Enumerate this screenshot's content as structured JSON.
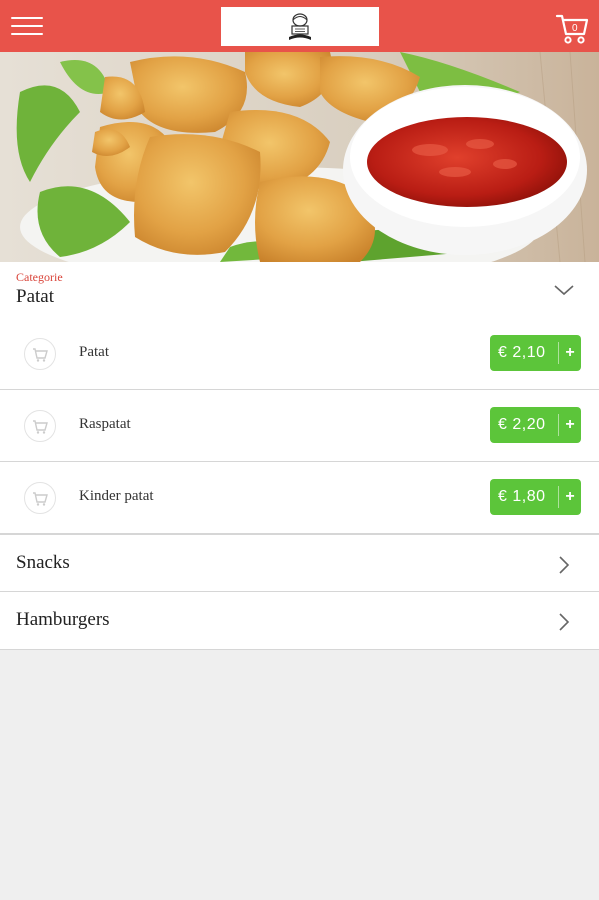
{
  "header": {
    "menu_icon": "hamburger-menu-icon",
    "logo_alt": "restaurant-logo",
    "cart_icon": "shopping-cart-icon",
    "cart_count": "0",
    "bar_color": "#e8534a"
  },
  "hero": {
    "description": "hero-image-chicken-nuggets-ketchup"
  },
  "category": {
    "label": "Categorie",
    "title": "Patat",
    "chevron_icon": "chevron-down-icon"
  },
  "items": [
    {
      "name": "Patat",
      "price": "€ 2,10",
      "add": "+"
    },
    {
      "name": "Raspatat",
      "price": "€ 2,20",
      "add": "+"
    },
    {
      "name": "Kinder patat",
      "price": "€ 1,80",
      "add": "+"
    }
  ],
  "other_categories": [
    {
      "label": "Snacks"
    },
    {
      "label": "Hamburgers"
    }
  ],
  "colors": {
    "accent": "#e8534a",
    "price_button": "#5cc53a",
    "category_label": "#d9443a"
  }
}
